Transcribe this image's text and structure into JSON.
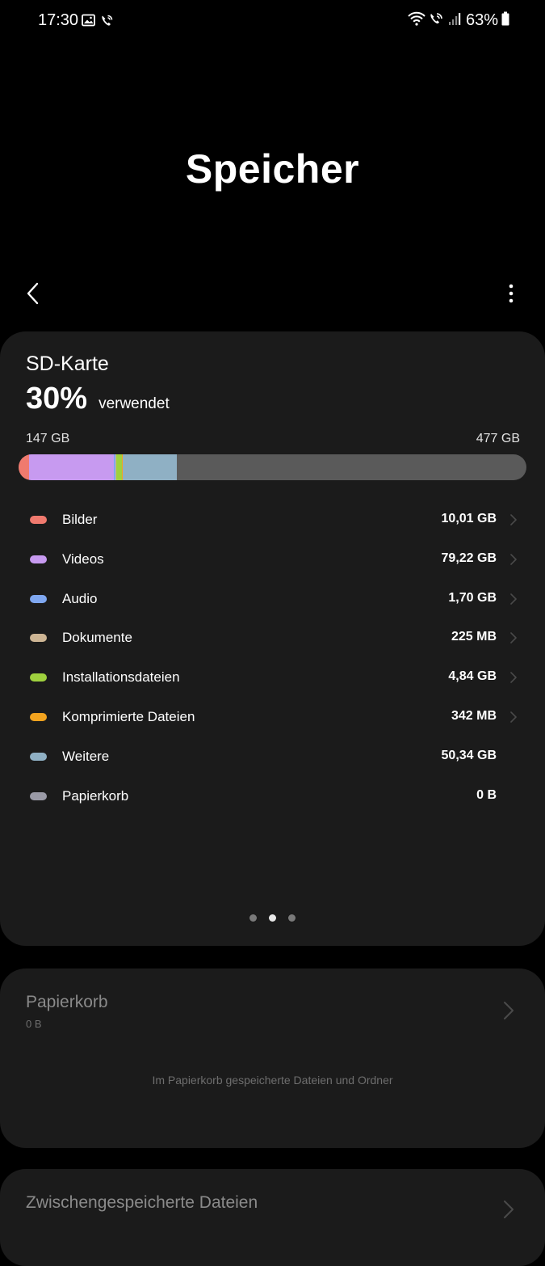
{
  "status_bar": {
    "time": "17:30",
    "battery_percent": "63%",
    "icons_left": [
      "gallery-icon",
      "wifi-calling-icon"
    ],
    "icons_right": [
      "wifi-icon",
      "wifi-calling-icon",
      "signal-icon",
      "battery-icon"
    ]
  },
  "header": {
    "title": "Speicher"
  },
  "storage_card": {
    "name": "SD-Karte",
    "used_percent": "30%",
    "used_text": "verwendet",
    "used_amount": "147 GB",
    "total_amount": "477 GB",
    "usage_fraction": 0.3,
    "categories": [
      {
        "label": "Bilder",
        "value": "10,01 GB",
        "color": "#f07a6e",
        "has_chevron": true
      },
      {
        "label": "Videos",
        "value": "79,22 GB",
        "color": "#c79af0",
        "has_chevron": true
      },
      {
        "label": "Audio",
        "value": "1,70 GB",
        "color": "#7fa7f0",
        "has_chevron": true
      },
      {
        "label": "Dokumente",
        "value": "225 MB",
        "color": "#cdb594",
        "has_chevron": true
      },
      {
        "label": "Installationsdateien",
        "value": "4,84 GB",
        "color": "#9fd13e",
        "has_chevron": true
      },
      {
        "label": "Komprimierte Dateien",
        "value": "342 MB",
        "color": "#f2a31f",
        "has_chevron": true
      },
      {
        "label": "Weitere",
        "value": "50,34 GB",
        "color": "#8fb0c4",
        "has_chevron": false
      },
      {
        "label": "Papierkorb",
        "value": "0 B",
        "color": "#9a9aa6",
        "has_chevron": false
      }
    ],
    "page_indicator": {
      "count": 3,
      "active": 1
    }
  },
  "trash_card": {
    "title": "Papierkorb",
    "size": "0 B",
    "description": "Im Papierkorb gespeicherte Dateien und Ordner"
  },
  "cache_card": {
    "title": "Zwischengespeicherte Dateien"
  },
  "colors": {
    "background": "#000000",
    "card": "#1b1b1b",
    "bar_track": "#5a5a5a"
  }
}
